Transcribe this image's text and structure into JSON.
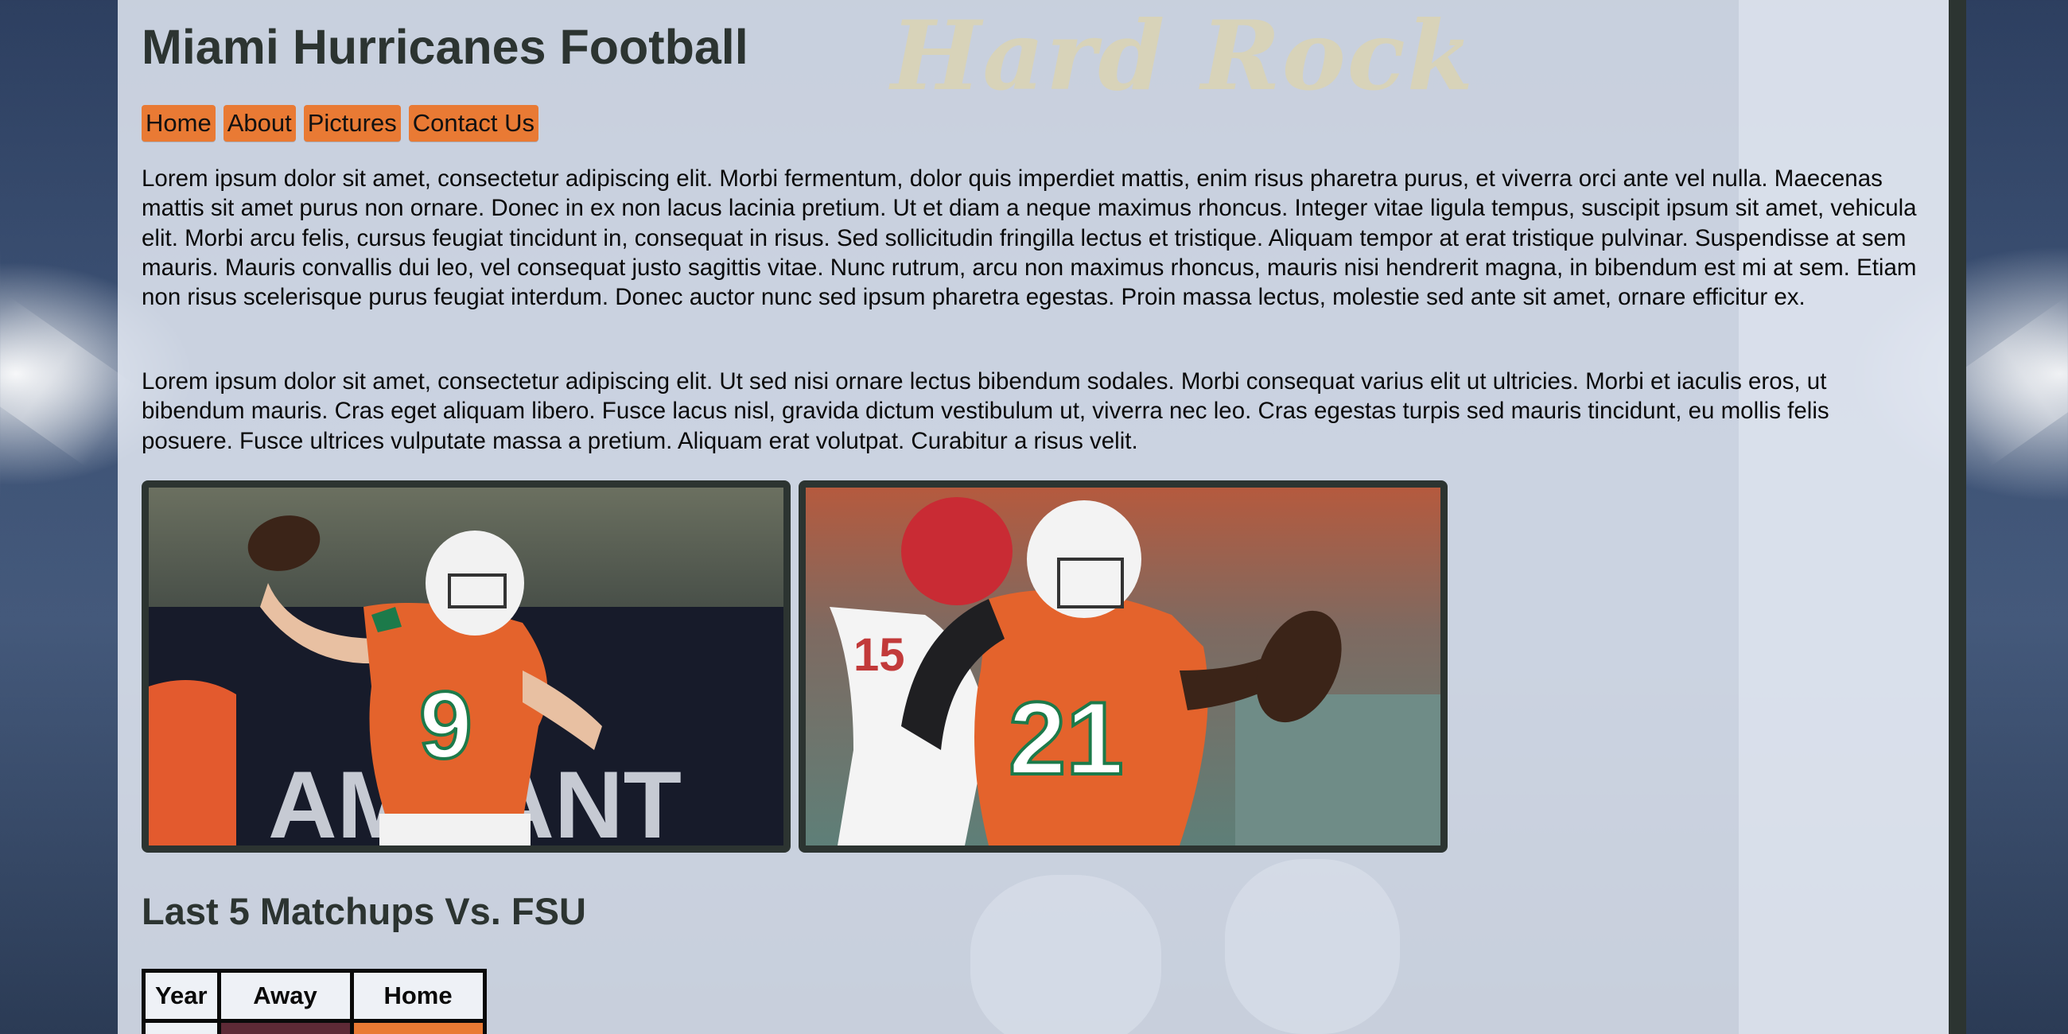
{
  "header": {
    "title": "Miami Hurricanes Football",
    "background_sign": "Hard Rock"
  },
  "nav": {
    "items": [
      {
        "label": "Home"
      },
      {
        "label": "About"
      },
      {
        "label": "Pictures"
      },
      {
        "label": "Contact Us"
      }
    ]
  },
  "content": {
    "paragraphs": [
      "Lorem ipsum dolor sit amet, consectetur adipiscing elit. Morbi fermentum, dolor quis imperdiet mattis, enim risus pharetra purus, et viverra orci ante vel nulla. Maecenas mattis sit amet purus non ornare. Donec in ex non lacus lacinia pretium. Ut et diam a neque maximus rhoncus. Integer vitae ligula tempus, suscipit ipsum sit amet, vehicula elit. Morbi arcu felis, cursus feugiat tincidunt in, consequat in risus. Sed sollicitudin fringilla lectus et tristique. Aliquam tempor at erat tristique pulvinar. Suspendisse at sem mauris. Mauris convallis dui leo, vel consequat justo sagittis vitae. Nunc rutrum, arcu non maximus rhoncus, mauris nisi hendrerit magna, in bibendum est mi at sem. Etiam non risus scelerisque purus feugiat interdum. Donec auctor nunc sed ipsum pharetra egestas. Proin massa lectus, molestie sed ante sit amet, ornare efficitur ex.",
      "Lorem ipsum dolor sit amet, consectetur adipiscing elit. Ut sed nisi ornare lectus bibendum sodales. Morbi consequat varius elit ut ultricies. Morbi et iaculis eros, ut bibendum mauris. Cras eget aliquam libero. Fusce lacus nisl, gravida dictum vestibulum ut, viverra nec leo. Cras egestas turpis sed mauris tincidunt, eu mollis felis posuere. Fusce ultrices vulputate massa a pretium. Aliquam erat volutpat. Curabitur a risus velit."
    ],
    "photos": [
      {
        "jersey_number": "9",
        "banner_text": "AMBANT"
      },
      {
        "jersey_number": "21",
        "opponent_number": "15"
      }
    ]
  },
  "matchups": {
    "title": "Last 5 Matchups Vs. FSU",
    "columns": [
      "Year",
      "Away",
      "Home"
    ]
  },
  "colors": {
    "accent_orange": "#e97a34",
    "dark_green": "#2c3431",
    "panel": "#e2e8f2"
  }
}
